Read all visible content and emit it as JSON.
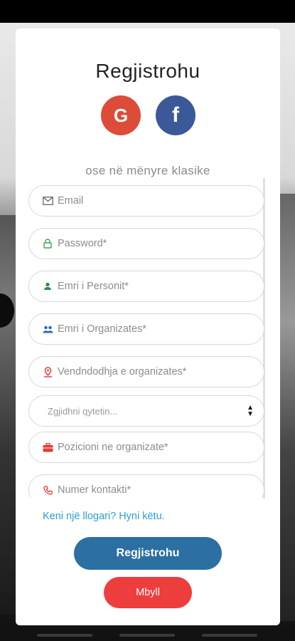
{
  "page": {
    "title": "Regjistrohu",
    "alt_label": "ose në mënyre klasike"
  },
  "social": {
    "google_letter": "G",
    "facebook_letter": "f",
    "google_color": "#dd4b39",
    "facebook_color": "#3b5998"
  },
  "form": {
    "email_placeholder": "Email",
    "password_placeholder": "Password*",
    "person_name_placeholder": "Emri i Personit*",
    "organization_name_placeholder": "Emri i Organizates*",
    "location_placeholder": "Vendndodhja e organizates*",
    "city_select_value": "Zgjidhni qytetin...",
    "position_placeholder": "Pozicioni ne organizate*",
    "contact_placeholder": "Numer kontakti*"
  },
  "links": {
    "login_text": "Keni një llogari? Hyni këtu."
  },
  "buttons": {
    "register_label": "Regjistrohu",
    "close_label": "Mbyll",
    "register_color": "#2c6fa3",
    "close_color": "#ee3d3d"
  },
  "icons": {
    "email": "envelope-icon",
    "password": "lock-icon",
    "person": "person-icon",
    "organization": "group-icon",
    "location": "location-pin-icon",
    "city": "chevron-updown-icon",
    "position": "briefcase-icon",
    "contact": "phone-icon"
  }
}
